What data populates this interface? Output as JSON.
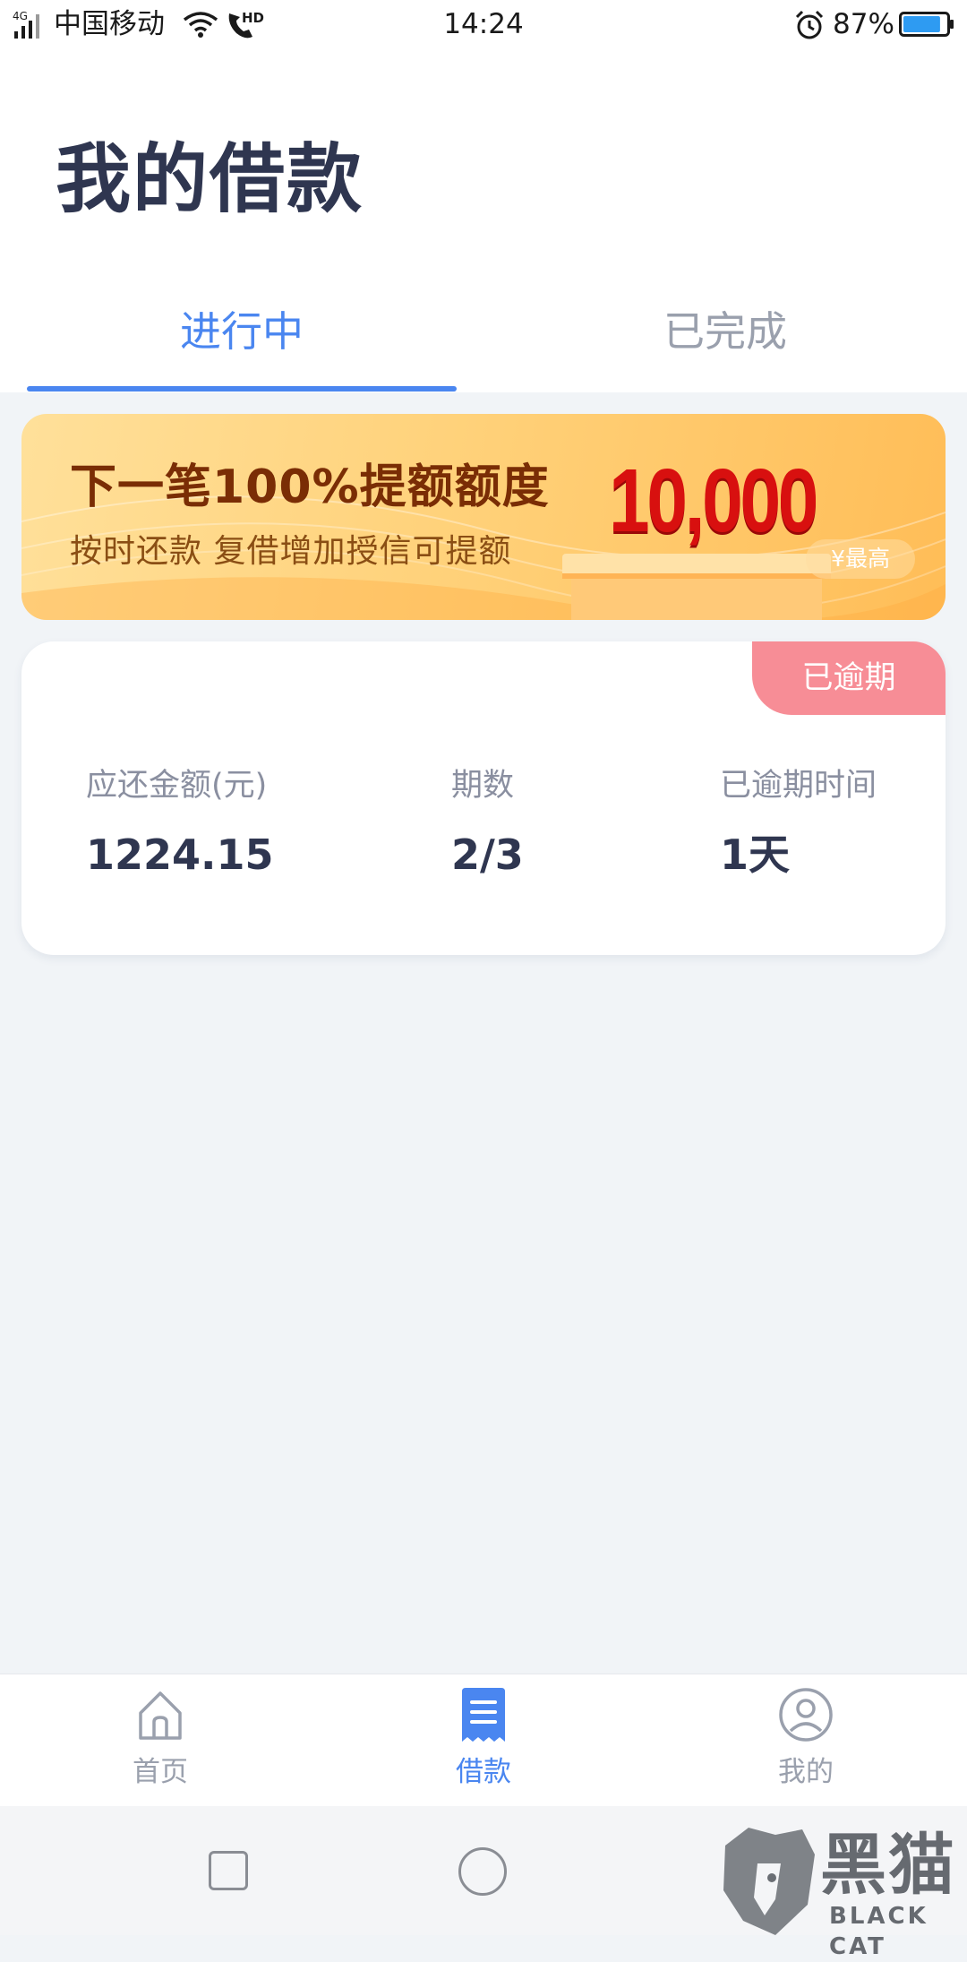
{
  "status_bar": {
    "network": "4G",
    "carrier": "中国移动",
    "hd": "HD",
    "time": "14:24",
    "battery": "87%",
    "battery_level": 0.87
  },
  "header": {
    "title": "我的借款",
    "tabs": [
      {
        "label": "进行中",
        "active": true
      },
      {
        "label": "已完成",
        "active": false
      }
    ]
  },
  "banner": {
    "title": "下一笔100%提额额度",
    "subtitle": "按时还款  复借增加授信可提额",
    "amount": "10,000",
    "amount_tag": "¥最高"
  },
  "loan_card": {
    "status": "已逾期",
    "columns": [
      {
        "label": "应还金额(元)",
        "value": "1224.15"
      },
      {
        "label": "期数",
        "value": "2/3"
      },
      {
        "label": "已逾期时间",
        "value": "1天"
      }
    ]
  },
  "bottom_nav": [
    {
      "label": "首页",
      "icon": "home-icon",
      "active": false
    },
    {
      "label": "借款",
      "icon": "loan-document-icon",
      "active": true
    },
    {
      "label": "我的",
      "icon": "user-profile-icon",
      "active": false
    }
  ],
  "watermark": {
    "cn": "黑猫",
    "en": "BLACK CAT"
  },
  "colors": {
    "accent": "#4a86f0",
    "title": "#2f3650",
    "overdue_badge": "#f78d96",
    "banner_amount": "#d8100f",
    "background": "#f1f4f7"
  }
}
